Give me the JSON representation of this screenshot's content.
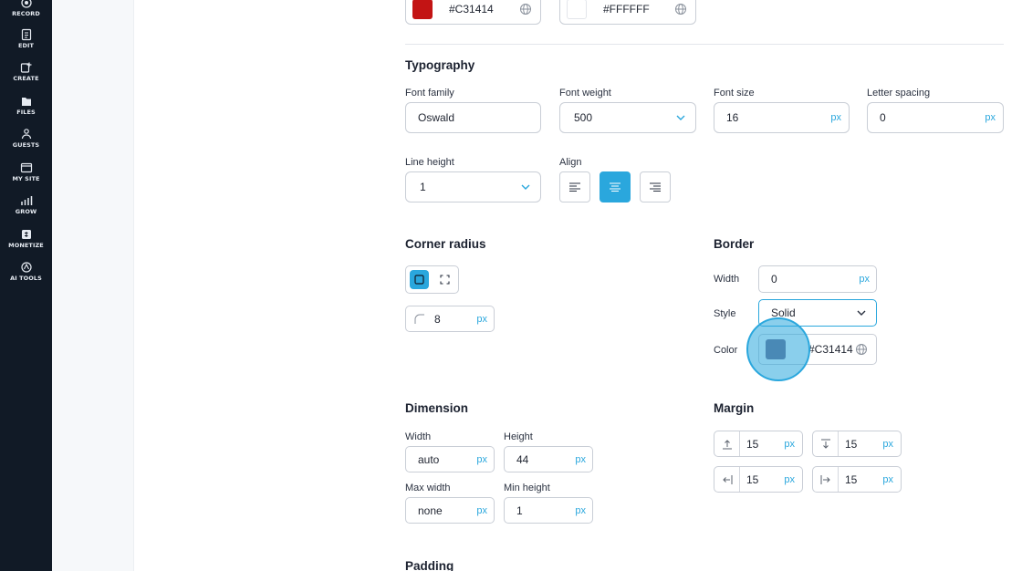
{
  "nav": {
    "items": [
      {
        "label": "RECORD",
        "icon": "record-icon"
      },
      {
        "label": "EDIT",
        "icon": "edit-icon"
      },
      {
        "label": "CREATE",
        "icon": "create-icon"
      },
      {
        "label": "FILES",
        "icon": "files-icon"
      },
      {
        "label": "GUESTS",
        "icon": "guests-icon"
      },
      {
        "label": "MY SITE",
        "icon": "my-site-icon"
      },
      {
        "label": "GROW",
        "icon": "grow-icon"
      },
      {
        "label": "MONETIZE",
        "icon": "monetize-icon"
      },
      {
        "label": "AI TOOLS",
        "icon": "ai-tools-icon"
      }
    ]
  },
  "colors_top": {
    "first": {
      "hex": "#C31414",
      "swatch": "#C31414"
    },
    "second": {
      "hex": "#FFFFFF",
      "swatch": "#FFFFFF"
    }
  },
  "typography": {
    "heading": "Typography",
    "font_family": {
      "label": "Font family",
      "value": "Oswald"
    },
    "font_weight": {
      "label": "Font weight",
      "value": "500"
    },
    "font_size": {
      "label": "Font size",
      "value": "16",
      "unit": "px"
    },
    "letter_spacing": {
      "label": "Letter spacing",
      "value": "0",
      "unit": "px"
    },
    "line_height": {
      "label": "Line height",
      "value": "1"
    },
    "align": {
      "label": "Align",
      "options": [
        "left",
        "center",
        "right"
      ],
      "selected": "center"
    }
  },
  "corner_radius": {
    "heading": "Corner radius",
    "value": "8",
    "unit": "px"
  },
  "border": {
    "heading": "Border",
    "width_label": "Width",
    "width_value": "0",
    "width_unit": "px",
    "style_label": "Style",
    "style_value": "Solid",
    "color_label": "Color",
    "color_value": "#C31414",
    "color_swatch": "#6f6488"
  },
  "dimension": {
    "heading": "Dimension",
    "width": {
      "label": "Width",
      "value": "auto",
      "unit": "px"
    },
    "height": {
      "label": "Height",
      "value": "44",
      "unit": "px"
    },
    "max_width": {
      "label": "Max width",
      "value": "none",
      "unit": "px"
    },
    "min_height": {
      "label": "Min height",
      "value": "1",
      "unit": "px"
    }
  },
  "margin": {
    "heading": "Margin",
    "top": {
      "value": "15",
      "unit": "px"
    },
    "bottom": {
      "value": "15",
      "unit": "px"
    },
    "left": {
      "value": "15",
      "unit": "px"
    },
    "right": {
      "value": "15",
      "unit": "px"
    }
  },
  "padding": {
    "heading": "Padding"
  },
  "accent": "#2AA7DD"
}
